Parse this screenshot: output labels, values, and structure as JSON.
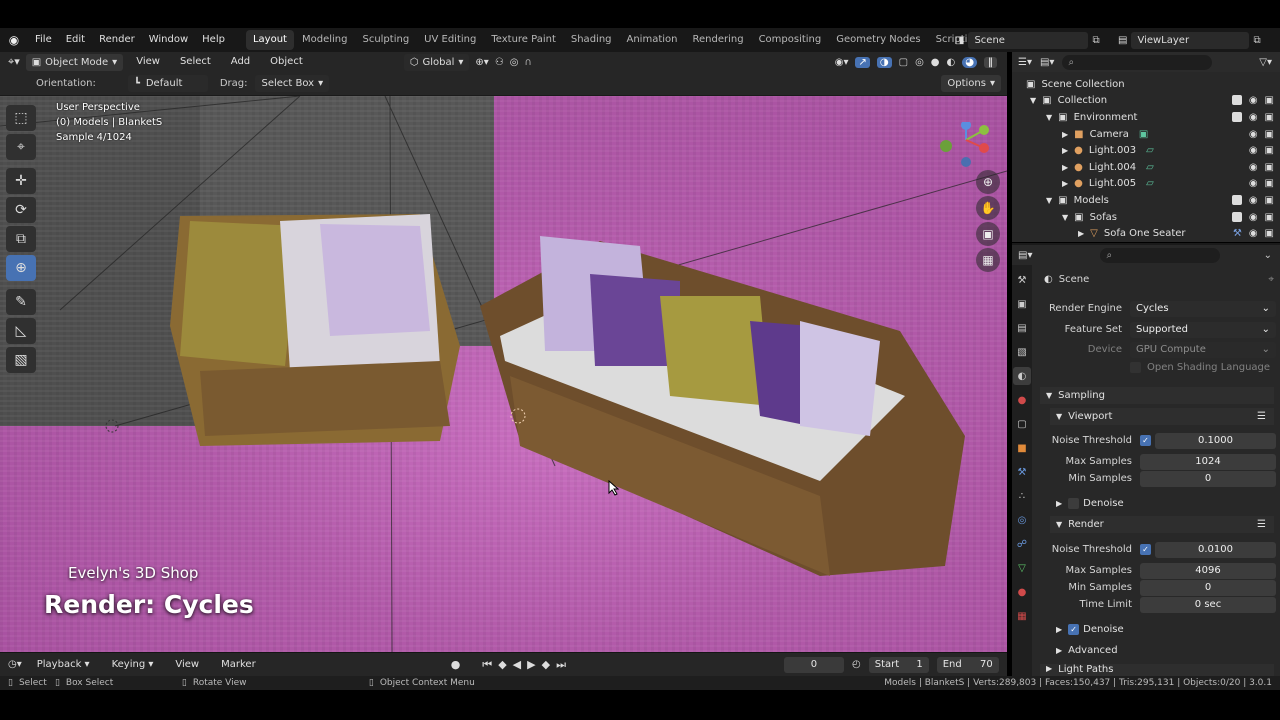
{
  "menu": {
    "items": [
      "File",
      "Edit",
      "Render",
      "Window",
      "Help"
    ],
    "workspaces": [
      "Layout",
      "Modeling",
      "Sculpting",
      "UV Editing",
      "Texture Paint",
      "Shading",
      "Animation",
      "Rendering",
      "Compositing",
      "Geometry Nodes",
      "Scripting"
    ],
    "active_workspace": "Layout",
    "add_tab": "+",
    "scene": "Scene",
    "view_layer": "ViewLayer"
  },
  "viewport_header": {
    "mode": "Object Mode",
    "menus": [
      "View",
      "Select",
      "Add",
      "Object"
    ],
    "transform": "Global"
  },
  "tool_settings": {
    "orientation_label": "Orientation:",
    "orientation_value": "Default",
    "drag_label": "Drag:",
    "drag_value": "Select Box",
    "options": "Options"
  },
  "overlay": {
    "perspective": "User Perspective",
    "collection": "(0) Models | BlanketS",
    "sample": "Sample 4/1024"
  },
  "watermark": {
    "shop": "Evelyn's 3D Shop",
    "title": "Render: Cycles"
  },
  "timeline": {
    "menus": [
      "Playback",
      "Keying",
      "View",
      "Marker"
    ],
    "current_frame": "0",
    "start_label": "Start",
    "start": "1",
    "end_label": "End",
    "end": "70"
  },
  "status": {
    "select": "Select",
    "box_select": "Box Select",
    "rotate": "Rotate View",
    "context": "Object Context Menu",
    "stats": "Models | BlanketS | Verts:289,803 | Faces:150,437 | Tris:295,131 | Objects:0/20 | 3.0.1"
  },
  "outliner": {
    "rows": [
      {
        "label": "Scene Collection",
        "indent": 0
      },
      {
        "label": "Collection",
        "indent": 1
      },
      {
        "label": "Environment",
        "indent": 2
      },
      {
        "label": "Camera",
        "indent": 3
      },
      {
        "label": "Light.003",
        "indent": 3
      },
      {
        "label": "Light.004",
        "indent": 3
      },
      {
        "label": "Light.005",
        "indent": 3
      },
      {
        "label": "Models",
        "indent": 1
      },
      {
        "label": "Sofas",
        "indent": 2
      },
      {
        "label": "Sofa One Seater",
        "indent": 3
      }
    ]
  },
  "properties": {
    "context": "Scene",
    "render_engine_label": "Render Engine",
    "render_engine": "Cycles",
    "feature_set_label": "Feature Set",
    "feature_set": "Supported",
    "device_label": "Device",
    "device": "GPU Compute",
    "osl": "Open Shading Language",
    "sampling": "Sampling",
    "viewport": "Viewport",
    "noise_threshold_label": "Noise Threshold",
    "vp_noise_threshold": "0.1000",
    "max_samples_label": "Max Samples",
    "vp_max_samples": "1024",
    "min_samples_label": "Min Samples",
    "vp_min_samples": "0",
    "denoise": "Denoise",
    "render": "Render",
    "r_noise_threshold": "0.0100",
    "r_max_samples": "4096",
    "r_min_samples": "0",
    "time_limit_label": "Time Limit",
    "time_limit": "0 sec",
    "advanced": "Advanced",
    "light_paths": "Light Paths"
  }
}
